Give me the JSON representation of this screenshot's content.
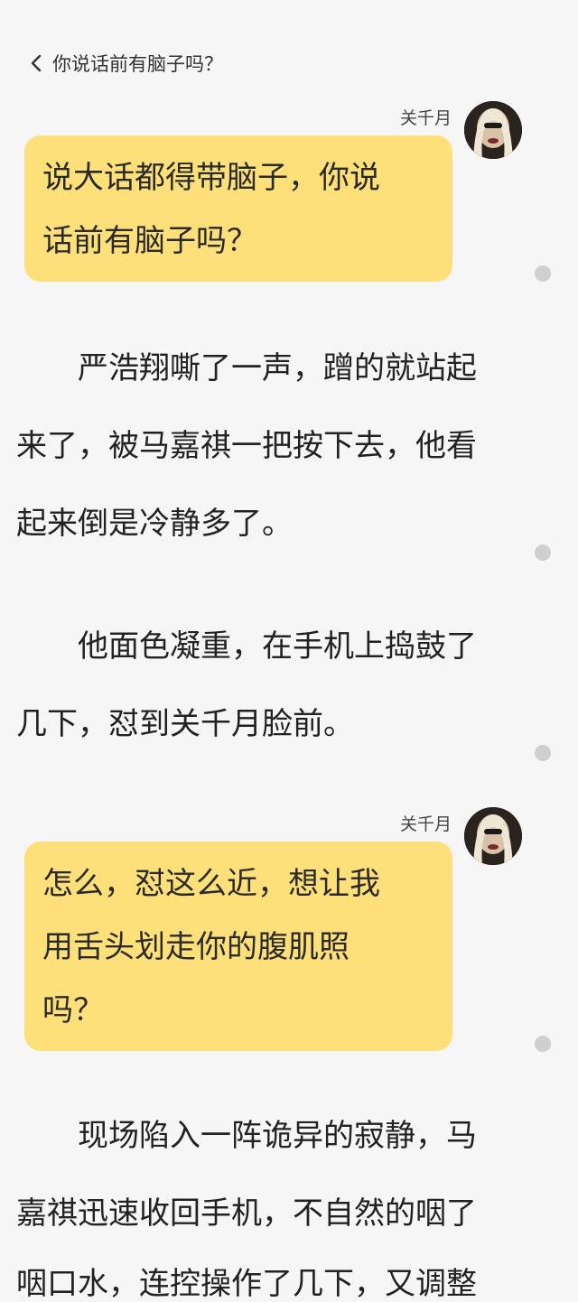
{
  "header": {
    "back_title": "你说话前有脑子吗？"
  },
  "messages": [
    {
      "speaker": "关千月",
      "lines": [
        "说大话都得带脑子，你说",
        "话前有脑子吗？"
      ]
    },
    {
      "speaker": "关千月",
      "lines": [
        "怎么，怼这么近，想让我",
        "用舌头划走你的腹肌照",
        "吗？"
      ]
    }
  ],
  "paragraphs": [
    [
      "　　严浩翔嘶了一声，蹭的就站起",
      "来了，被马嘉祺一把按下去，他看",
      "起来倒是冷静多了。"
    ],
    [
      "　　他面色凝重，在手机上捣鼓了",
      "几下，怼到关千月脸前。"
    ],
    [
      "　　现场陷入一阵诡异的寂静，马",
      "嘉祺迅速收回手机，不自然的咽了",
      "咽口水，连控操作了几下，又调整"
    ]
  ]
}
